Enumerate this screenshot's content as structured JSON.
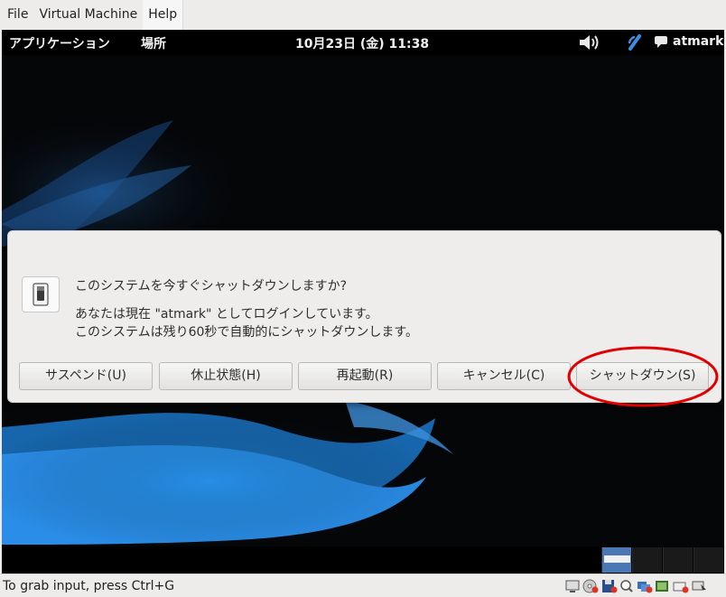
{
  "host_menu": [
    "File",
    "Virtual Machine",
    "Help"
  ],
  "topbar": {
    "applications": "アプリケーション",
    "places": "場所",
    "clock": "10月23日 (金) 11:38",
    "user": "atmark"
  },
  "dialog": {
    "title": "このシステムを今すぐシャットダウンしますか?",
    "line1": "あなたは現在 \"atmark\" としてログインしています。",
    "line2": "このシステムは残り60秒で自動的にシャットダウンします。",
    "buttons": {
      "suspend": "サスペンド(U)",
      "hibernate": "休止状態(H)",
      "restart": "再起動(R)",
      "cancel": "キャンセル(C)",
      "shutdown": "シャットダウン(S)"
    },
    "highlight_color": "#e00000"
  },
  "workspaces": {
    "count": 4,
    "active": 1
  },
  "statusbar": {
    "message": "To grab input, press Ctrl+G",
    "icons": [
      "display-icon",
      "cdrom-icon",
      "floppy-icon",
      "usb-icon",
      "network-icon",
      "sound-icon",
      "shared-folder-icon",
      "mouse-icon"
    ]
  }
}
